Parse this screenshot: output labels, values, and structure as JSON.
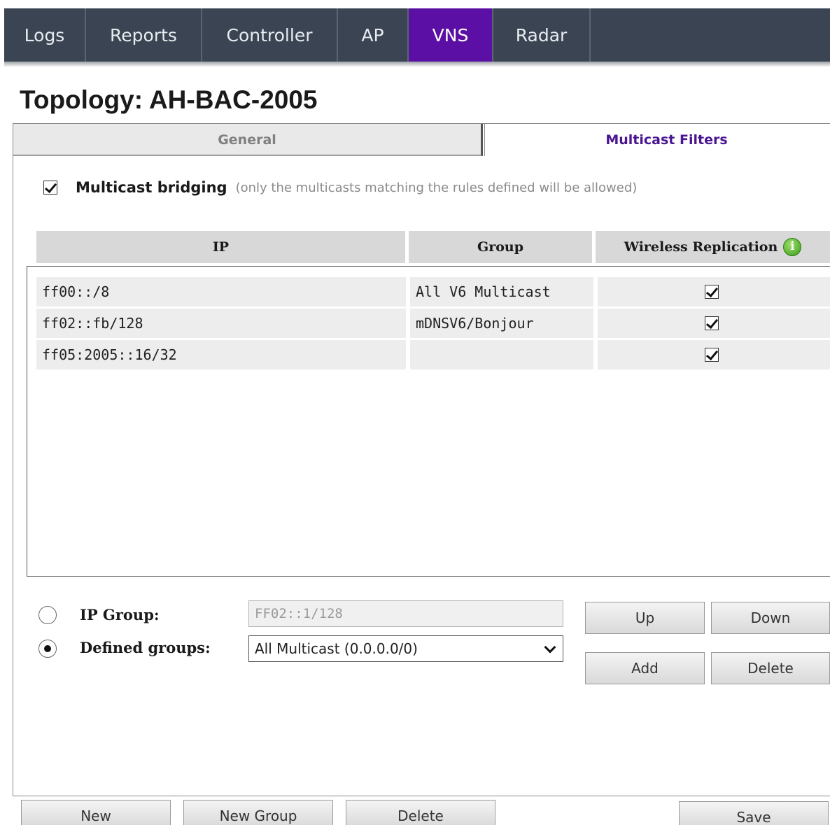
{
  "nav": {
    "tabs": [
      {
        "label": "Logs"
      },
      {
        "label": "Reports"
      },
      {
        "label": "Controller"
      },
      {
        "label": "AP"
      },
      {
        "label": "VNS"
      },
      {
        "label": "Radar"
      }
    ],
    "active_index": 4,
    "active_color": "#5b0fa4"
  },
  "page_title": "Topology: AH-BAC-2005",
  "subtabs": {
    "general": "General",
    "multicast": "Multicast Filters"
  },
  "bridging": {
    "checked": true,
    "label": "Multicast bridging",
    "note": "(only the multicasts matching the rules defined will be allowed)"
  },
  "table": {
    "headers": {
      "ip": "IP",
      "group": "Group",
      "wireless_replication": "Wireless Replication"
    },
    "info_icon": "info-icon",
    "rows": [
      {
        "ip": "ff00::/8",
        "group": "All V6 Multicast",
        "replication": true
      },
      {
        "ip": "ff02::fb/128",
        "group": "mDNSV6/Bonjour",
        "replication": true
      },
      {
        "ip": "ff05:2005::16/32",
        "group": "",
        "replication": true
      }
    ]
  },
  "controls": {
    "ip_group_label": "IP Group:",
    "ip_group_value": "FF02::1/128",
    "defined_groups_label": "Defined groups:",
    "defined_groups_selected": "All Multicast (0.0.0.0/0)",
    "selected_radio": "defined_groups",
    "up": "Up",
    "down": "Down",
    "add": "Add",
    "delete": "Delete"
  },
  "footer": {
    "new": "New",
    "new_group": "New Group",
    "delete": "Delete",
    "save": "Save"
  }
}
